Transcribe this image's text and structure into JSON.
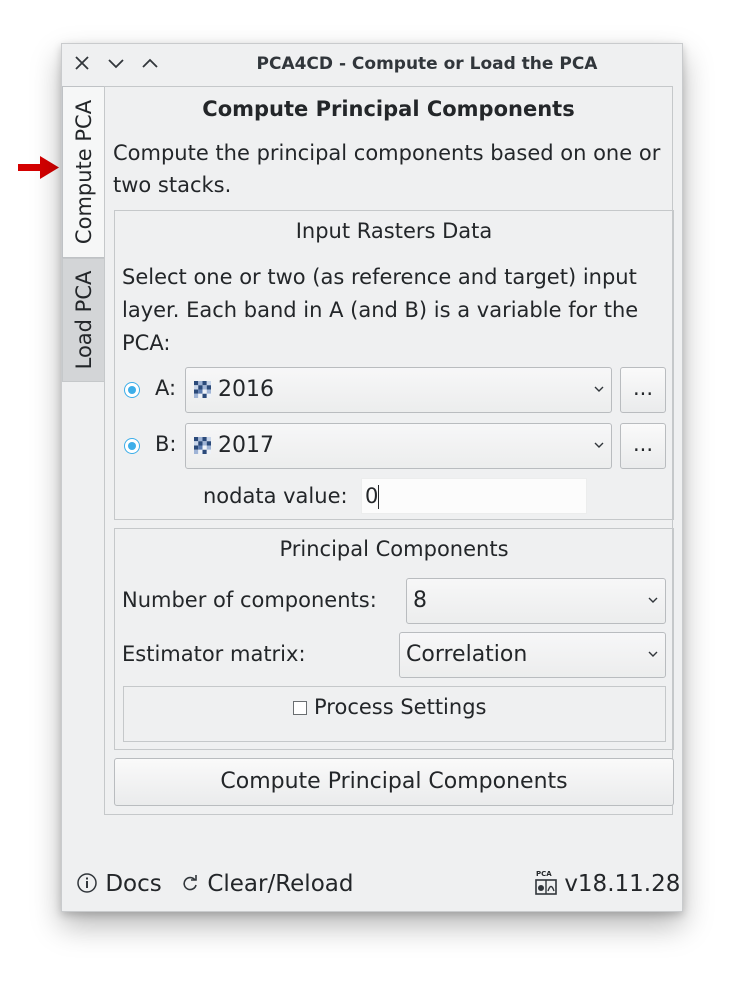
{
  "window": {
    "title": "PCA4CD - Compute or Load the PCA"
  },
  "tabs": [
    {
      "label": "Compute PCA",
      "active": true
    },
    {
      "label": "Load PCA",
      "active": false
    }
  ],
  "panel": {
    "title": "Compute Principal Components",
    "description": "Compute the principal components based on one or two stacks."
  },
  "input_group": {
    "title": "Input Rasters Data",
    "description": "Select one or two (as reference and target) input layer. Each band in A (and B) is a variable for the PCA:",
    "layer_a": {
      "label": "A:",
      "value": "2016",
      "browse_label": "..."
    },
    "layer_b": {
      "label": "B:",
      "value": "2017",
      "browse_label": "..."
    },
    "nodata": {
      "label": "nodata value:",
      "value": "0"
    }
  },
  "pc_group": {
    "title": "Principal Components",
    "num_components_label": "Number of components:",
    "num_components_value": "8",
    "estimator_label": "Estimator matrix:",
    "estimator_value": "Correlation",
    "process_settings_label": "Process Settings"
  },
  "compute_button": "Compute Principal Components",
  "footer": {
    "docs": "Docs",
    "clear_reload": "Clear/Reload",
    "version": "v18.11.28",
    "logo_text": "PCA"
  },
  "colors": {
    "accent": "#3daee9",
    "indicator_arrow": "#d40000"
  }
}
